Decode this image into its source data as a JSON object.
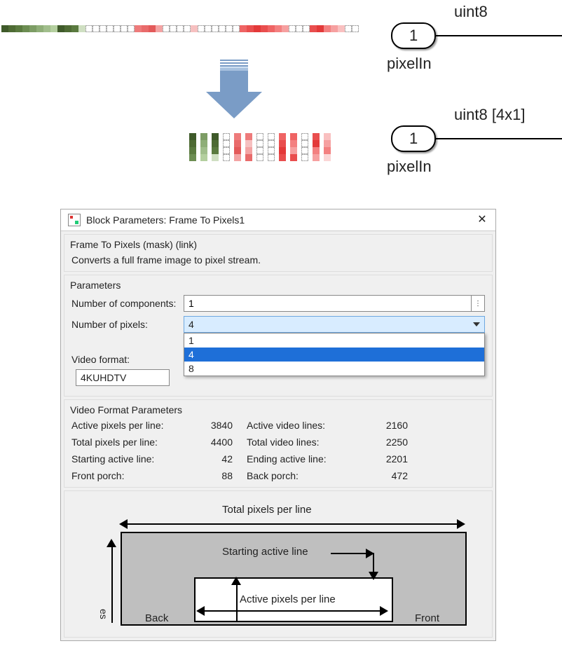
{
  "ports": {
    "upper": {
      "number": "1",
      "name": "pixelIn",
      "type": "uint8"
    },
    "lower": {
      "number": "1",
      "name": "pixelIn",
      "type": "uint8 [4x1]"
    }
  },
  "dialog": {
    "title": "Block Parameters: Frame To Pixels1",
    "mask_title": "Frame To Pixels (mask) (link)",
    "mask_desc": "Converts a full frame image to pixel stream.",
    "params_title": "Parameters",
    "num_components_label": "Number of components:",
    "num_components_value": "1",
    "num_pixels_label": "Number of pixels:",
    "num_pixels_value": "4",
    "num_pixels_options": [
      "1",
      "4",
      "8"
    ],
    "video_format_label": "Video format:",
    "video_format_value": "4KUHDTV",
    "vfp_title": "Video Format Parameters",
    "vfp": {
      "active_px_line_label": "Active pixels per line:",
      "active_px_line_value": "3840",
      "active_lines_label": "Active video lines:",
      "active_lines_value": "2160",
      "total_px_line_label": "Total pixels per line:",
      "total_px_line_value": "4400",
      "total_lines_label": "Total video lines:",
      "total_lines_value": "2250",
      "start_line_label": "Starting active line:",
      "start_line_value": "42",
      "end_line_label": "Ending active line:",
      "end_line_value": "2201",
      "front_porch_label": "Front porch:",
      "front_porch_value": "88",
      "back_porch_label": "Back porch:",
      "back_porch_value": "472"
    },
    "diagram": {
      "total_px": "Total pixels per line",
      "start_line": "Starting active line",
      "active_px": "Active pixels per line",
      "back": "Back",
      "front": "Front",
      "vaxis": "es"
    }
  }
}
